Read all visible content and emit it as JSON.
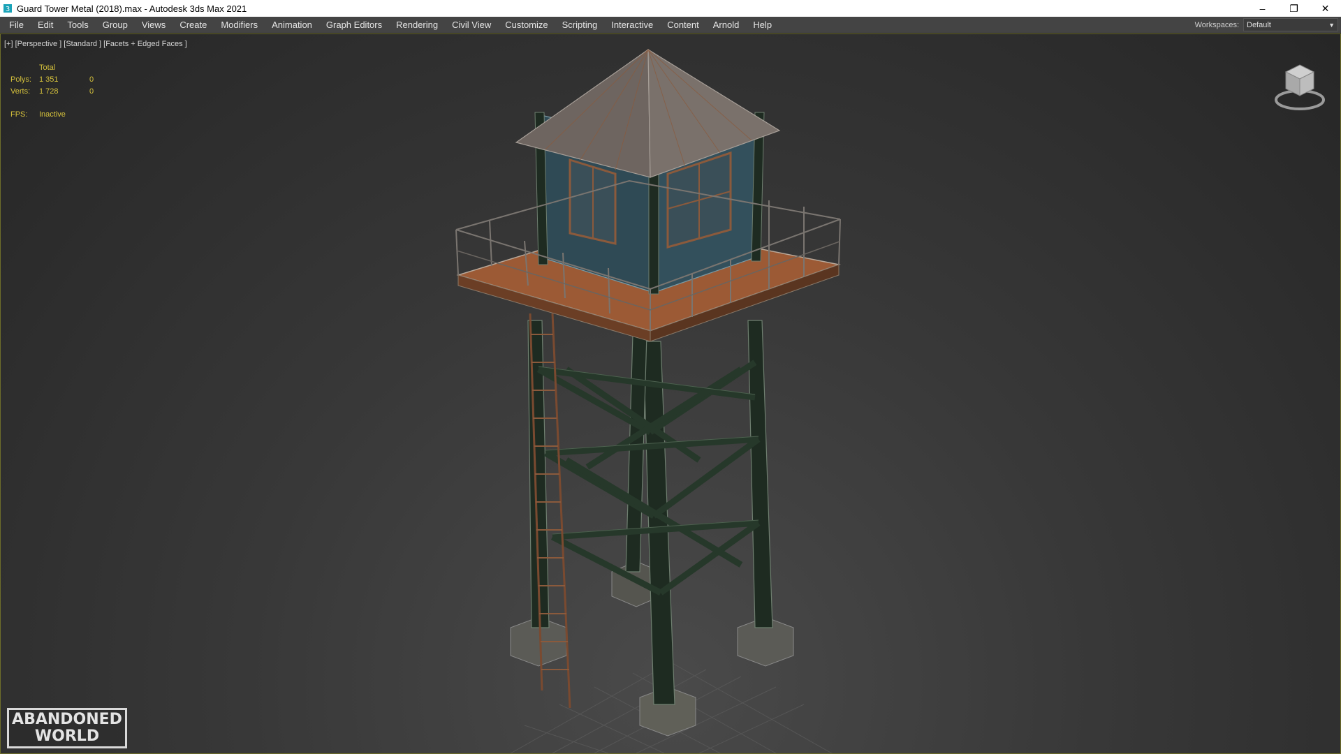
{
  "window": {
    "title": "Guard Tower Metal (2018).max - Autodesk 3ds Max 2021",
    "controls": {
      "minimize": "–",
      "restore": "❐",
      "close": "✕"
    }
  },
  "menu": {
    "items": [
      "File",
      "Edit",
      "Tools",
      "Group",
      "Views",
      "Create",
      "Modifiers",
      "Animation",
      "Graph Editors",
      "Rendering",
      "Civil View",
      "Customize",
      "Scripting",
      "Interactive",
      "Content",
      "Arnold",
      "Help"
    ]
  },
  "workspaces": {
    "label": "Workspaces:",
    "value": "Default"
  },
  "viewport": {
    "label": "[+] [Perspective ] [Standard ] [Facets + Edged Faces ]",
    "stats": {
      "header": "Total",
      "polys_label": "Polys:",
      "polys_total": "1 351",
      "polys_sel": "0",
      "verts_label": "Verts:",
      "verts_total": "1 728",
      "verts_sel": "0",
      "fps_label": "FPS:",
      "fps_value": "Inactive"
    }
  },
  "logo": {
    "line1": "ABANDONED",
    "line2": "WORLD"
  },
  "colors": {
    "stats_text": "#d6c23c",
    "viewport_border": "#6e6e2a",
    "cabin": "#2f4a55",
    "frame": "#1f2e24",
    "rust_floor": "#9c5a35"
  }
}
